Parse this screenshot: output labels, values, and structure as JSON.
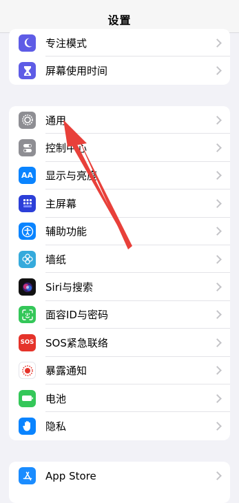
{
  "nav": {
    "title": "设置"
  },
  "groups": [
    {
      "items": [
        {
          "label": "专注模式",
          "icon": "moon-icon",
          "color": "#5e5ce6"
        },
        {
          "label": "屏幕使用时间",
          "icon": "hourglass-icon",
          "color": "#5e5ce6"
        }
      ]
    },
    {
      "items": [
        {
          "label": "通用",
          "icon": "gear-icon",
          "color": "#8e8e93"
        },
        {
          "label": "控制中心",
          "icon": "toggles-icon",
          "color": "#8e8e93"
        },
        {
          "label": "显示与亮度",
          "icon": "text-size-icon",
          "color": "#0a84ff"
        },
        {
          "label": "主屏幕",
          "icon": "home-grid-icon",
          "color": "#2c3fd8"
        },
        {
          "label": "辅助功能",
          "icon": "accessibility-icon",
          "color": "#0a84ff"
        },
        {
          "label": "墙纸",
          "icon": "flower-icon",
          "color": "#35aadc"
        },
        {
          "label": "Siri与搜索",
          "icon": "siri-icon",
          "color": "#000000"
        },
        {
          "label": "面容ID与密码",
          "icon": "face-id-icon",
          "color": "#34c759"
        },
        {
          "label": "SOS紧急联络",
          "icon": "sos-icon",
          "color": "#e5332a",
          "icon_text": "SOS"
        },
        {
          "label": "暴露通知",
          "icon": "exposure-icon",
          "color": "#ffffff"
        },
        {
          "label": "电池",
          "icon": "battery-icon",
          "color": "#34c759"
        },
        {
          "label": "隐私",
          "icon": "hand-icon",
          "color": "#0a84ff"
        }
      ]
    },
    {
      "items": [
        {
          "label": "App Store",
          "icon": "app-store-icon",
          "color": "#1a8cff"
        }
      ]
    }
  ],
  "annotation": {
    "color": "#e8403a"
  }
}
